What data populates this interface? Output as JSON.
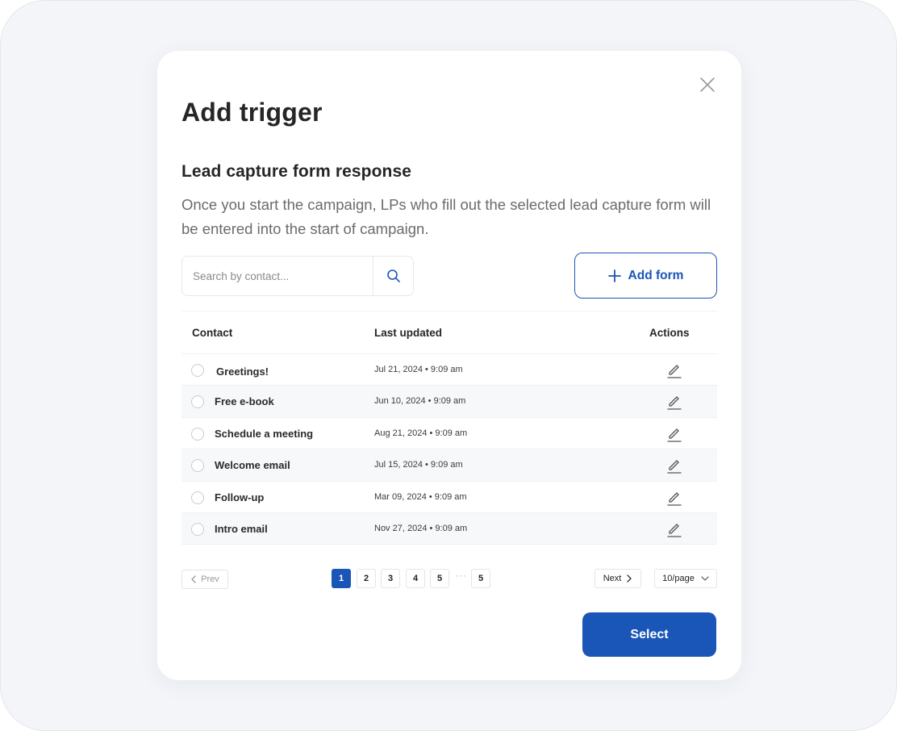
{
  "modal": {
    "title": "Add trigger",
    "subtitle": "Lead capture form response",
    "description": "Once you start the campaign, LPs who fill out the selected lead capture form will be entered into the start of campaign."
  },
  "search": {
    "placeholder": "Search by contact...",
    "value": ""
  },
  "add_form": {
    "label": "Add form"
  },
  "table": {
    "headers": {
      "contact": "Contact",
      "last_updated": "Last updated",
      "actions": "Actions"
    },
    "rows": [
      {
        "name": "Greetings!",
        "date": "Jul 21, 2024 • 9:09 am"
      },
      {
        "name": "Free e-book",
        "date": "Jun 10, 2024 • 9:09 am"
      },
      {
        "name": "Schedule a meeting",
        "date": "Aug 21, 2024 • 9:09 am"
      },
      {
        "name": "Welcome email",
        "date": "Jul 15, 2024 • 9:09 am"
      },
      {
        "name": "Follow-up",
        "date": "Mar 09, 2024 • 9:09 am"
      },
      {
        "name": "Intro email",
        "date": "Nov 27, 2024 • 9:09 am"
      }
    ]
  },
  "pagination": {
    "prev": "Prev",
    "pages": [
      "1",
      "2",
      "3",
      "4",
      "5"
    ],
    "ellipsis": "···",
    "last_page": "5",
    "current": "1",
    "next": "Next",
    "per_page": "10/page"
  },
  "actions": {
    "select": "Select"
  },
  "colors": {
    "accent": "#1a56b8",
    "background": "#f3f5f8",
    "row_shade": "#f7f8f9"
  },
  "icons": [
    "close-icon",
    "search-icon",
    "plus-icon",
    "edit-icon",
    "chevron-left-icon",
    "chevron-right-icon",
    "chevron-down-icon"
  ]
}
